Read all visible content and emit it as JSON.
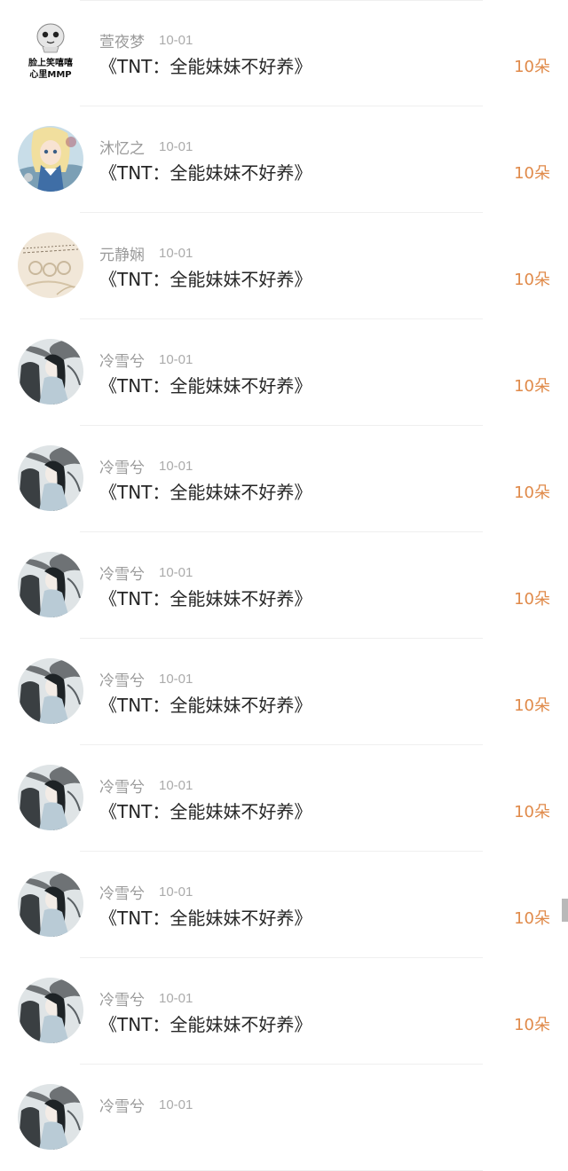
{
  "entries": [
    {
      "user": "萱夜梦",
      "date": "10-01",
      "title": "《TNT：全能妹妹不好养》",
      "gift": "10朵",
      "avatar": "meme-icon",
      "avatar_text": [
        "脸上笑嘻嘻",
        "心里MMP"
      ]
    },
    {
      "user": "沐忆之",
      "date": "10-01",
      "title": "《TNT：全能妹妹不好养》",
      "gift": "10朵",
      "avatar": "anime-girl-icon"
    },
    {
      "user": "元静娴",
      "date": "10-01",
      "title": "《TNT：全能妹妹不好养》",
      "gift": "10朵",
      "avatar": "vintage-card-icon"
    },
    {
      "user": "冷雪兮",
      "date": "10-01",
      "title": "《TNT：全能妹妹不好养》",
      "gift": "10朵",
      "avatar": "ink-portrait-icon"
    },
    {
      "user": "冷雪兮",
      "date": "10-01",
      "title": "《TNT：全能妹妹不好养》",
      "gift": "10朵",
      "avatar": "ink-portrait-icon"
    },
    {
      "user": "冷雪兮",
      "date": "10-01",
      "title": "《TNT：全能妹妹不好养》",
      "gift": "10朵",
      "avatar": "ink-portrait-icon"
    },
    {
      "user": "冷雪兮",
      "date": "10-01",
      "title": "《TNT：全能妹妹不好养》",
      "gift": "10朵",
      "avatar": "ink-portrait-icon"
    },
    {
      "user": "冷雪兮",
      "date": "10-01",
      "title": "《TNT：全能妹妹不好养》",
      "gift": "10朵",
      "avatar": "ink-portrait-icon"
    },
    {
      "user": "冷雪兮",
      "date": "10-01",
      "title": "《TNT：全能妹妹不好养》",
      "gift": "10朵",
      "avatar": "ink-portrait-icon"
    },
    {
      "user": "冷雪兮",
      "date": "10-01",
      "title": "《TNT：全能妹妹不好养》",
      "gift": "10朵",
      "avatar": "ink-portrait-icon"
    },
    {
      "user": "冷雪兮",
      "date": "10-01",
      "title": "",
      "gift": "",
      "avatar": "ink-portrait-icon"
    }
  ],
  "colors": {
    "gift": "#e08a4a",
    "username": "#9a9a9a",
    "title": "#262626",
    "divider": "#efefef"
  }
}
